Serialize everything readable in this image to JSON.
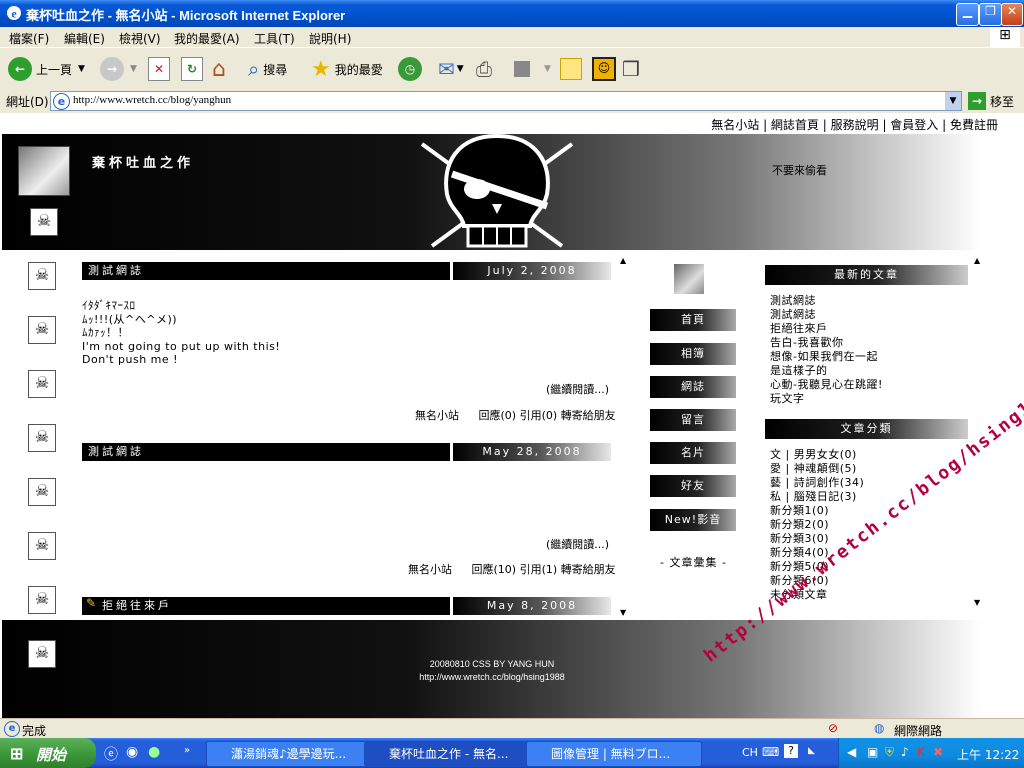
{
  "window": {
    "title": "棄杯吐血之作 - 無名小站 - Microsoft Internet Explorer"
  },
  "menu": [
    "檔案(F)",
    "編輯(E)",
    "檢視(V)",
    "我的最愛(A)",
    "工具(T)",
    "說明(H)"
  ],
  "toolbar": {
    "back_label": "上一頁",
    "search_label": "搜尋",
    "favorites_label": "我的最愛"
  },
  "address": {
    "label": "網址(D)",
    "url": "http://www.wretch.cc/blog/yanghun",
    "go_label": "移至"
  },
  "blog": {
    "topnav": [
      "無名小站",
      "網誌首頁",
      "服務說明",
      "會員登入",
      "免費註冊"
    ],
    "title": "棄杯吐血之作",
    "banner_note": "不要來偷看",
    "posts": [
      {
        "title": "測試網誌",
        "date": "July 2, 2008",
        "body": [
          "ｲﾀﾀﾞｷﾏｰｽﾛ",
          "ﾑｯ!!!(从^ヘ^メ))",
          "ﾑｶｧｯ！！",
          "I'm not going to put up with this!",
          "Don't push me !"
        ],
        "more": "(繼續閱讀...)",
        "footer": [
          "無名小站",
          "回應(0)",
          "引用(0)",
          "轉寄給朋友"
        ]
      },
      {
        "title": "測試網誌",
        "date": "May 28, 2008",
        "body": [],
        "more": "(繼續閱讀...)",
        "footer": [
          "無名小站",
          "回應(10)",
          "引用(1)",
          "轉寄給朋友"
        ]
      },
      {
        "title": "拒絕往來戶",
        "date": "May 8, 2008"
      }
    ],
    "nav": [
      "首頁",
      "相簿",
      "網誌",
      "留言",
      "名片",
      "好友",
      "New!影音"
    ],
    "nav_extra": "- 文章彙集 -",
    "recent": {
      "heading": "最新的文章",
      "items": [
        "測試網誌",
        "測試網誌",
        "拒絕往來戶",
        "告白-我喜歡你",
        "想像-如果我們在一起",
        "是這樣子的",
        "心動-我聽見心在跳躍!",
        "玩文字"
      ]
    },
    "categories": {
      "heading": "文章分類",
      "items": [
        "文 | 男男女女(0)",
        "愛 | 神魂顛倒(5)",
        "藝 | 詩詞創作(34)",
        "私 | 腦殘日記(3)",
        "新分類1(0)",
        "新分類2(0)",
        "新分類3(0)",
        "新分類4(0)",
        "新分類5(0)",
        "新分類6(0)",
        "未分類文章"
      ]
    },
    "footer": [
      "20080810 CSS BY YANG HUN",
      "http://www.wretch.cc/blog/hsing1988"
    ]
  },
  "statusbar": {
    "status": "完成",
    "zone": "網際網路"
  },
  "taskbar": {
    "start": "開始",
    "tasks": [
      "瀟湯銷魂♪邊學邊玩...",
      "棄杯吐血之作 - 無名...",
      "圖像管理 | 無料ブロ..."
    ],
    "ime": "CH",
    "clock": "上午 12:22"
  },
  "watermark": "http://www.wretch.cc/blog/hsing1988"
}
